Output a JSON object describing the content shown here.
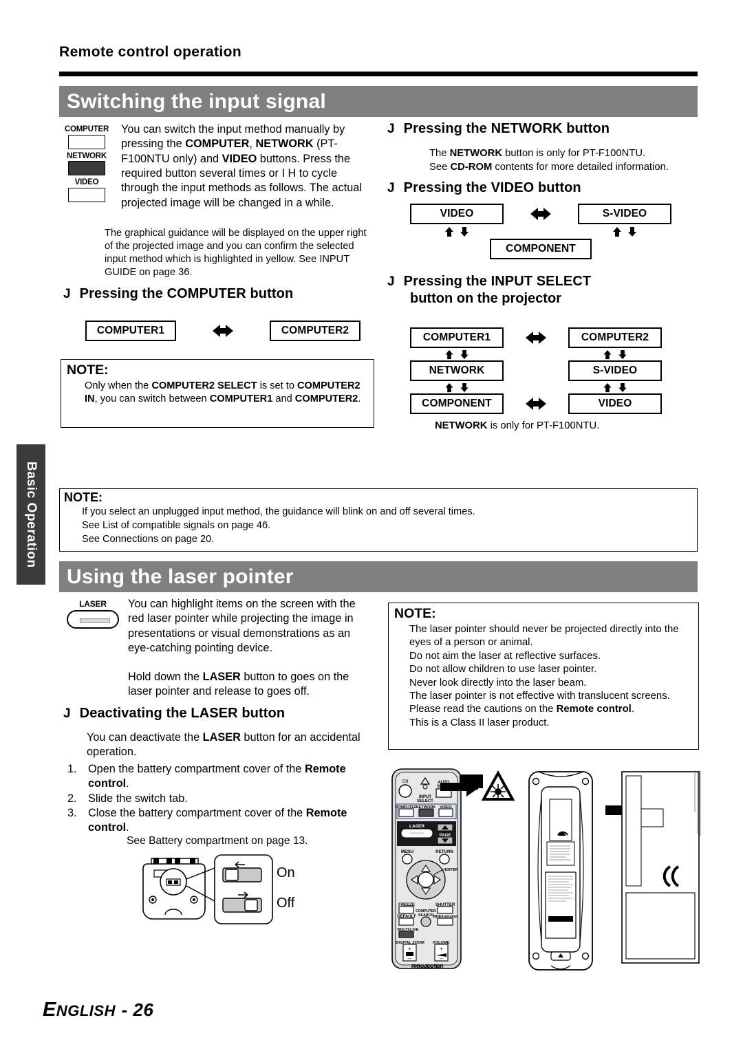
{
  "page": {
    "running_head": "Remote control operation",
    "footer_lead": "E",
    "footer_rest": "NGLISH",
    "footer_page": "- 26",
    "side_tab": "Basic Operation",
    "accent_gray": "#808080",
    "tab_gray": "#3b3b3b"
  },
  "section_switching": {
    "title": "Switching the input signal",
    "remote_keys": [
      {
        "label": "COMPUTER",
        "state": "light"
      },
      {
        "label": "NETWORK",
        "state": "dark"
      },
      {
        "label": "VIDEO",
        "state": "light"
      }
    ],
    "intro": {
      "l1a": "You can switch the input method manually by pressing the ",
      "l1b": "COMPUTER",
      "l1c": ", ",
      "l1d": "NETWORK",
      "l2a": " (PT-F100NTU only) and ",
      "l2b": "VIDEO",
      "l2c": " buttons. Press the required button several times or I H  to cycle through the input methods as follows. The actual projected image will be changed in a while."
    },
    "intro_note": "The graphical guidance will be displayed on the upper right of the projected image and you can confirm the selected input method which is highlighted in yellow. See  INPUT GUIDE  on page 36.",
    "computer_heading": {
      "bullet": "J",
      "text": "Pressing the COMPUTER button"
    },
    "computer_flow": {
      "left": "COMPUTER1",
      "arrow": "bidirectional-arrow",
      "right": "COMPUTER2"
    },
    "computer_note": {
      "head": "NOTE:",
      "a": "Only when the ",
      "b": "COMPUTER2 SELECT",
      "c": " is set to ",
      "d": "COMPUTER2 IN",
      "e": ", you can switch between ",
      "f": "COMPUTER1",
      "g": " and ",
      "h": "COMPUTER2",
      "i": "."
    },
    "network_heading": {
      "bullet": "J",
      "text": "Pressing the NETWORK button"
    },
    "network_body": {
      "l1a": "The ",
      "l1b": "NETWORK",
      "l1c": " button is only for PT-F100NTU.",
      "l2a": "See ",
      "l2b": "CD-ROM",
      "l2c": " contents for more detailed information."
    },
    "video_heading": {
      "bullet": "J",
      "text": "Pressing the VIDEO button"
    },
    "video_flow": {
      "video": "VIDEO",
      "svideo": "S-VIDEO",
      "component": "COMPONENT"
    },
    "inputselect_heading": {
      "bullet": "J",
      "line1": "Pressing the INPUT SELECT",
      "line2": "button on the projector"
    },
    "inputselect_flow": {
      "computer1": "COMPUTER1",
      "computer2": "COMPUTER2",
      "network": "NETWORK",
      "svideo": "S-VIDEO",
      "component": "COMPONENT",
      "video": "VIDEO"
    },
    "inputselect_footnote": {
      "a": "NETWORK",
      "b": " is only for PT-F100NTU."
    },
    "big_note": {
      "head": "NOTE:",
      "lines": [
        "If you select an unplugged input method, the guidance will blink on and off several times.",
        "See  List of compatible signals  on page 46.",
        "See  Connections  on page 20."
      ]
    }
  },
  "section_laser": {
    "title": "Using the laser pointer",
    "key_label": "LASER",
    "intro_p1": "You can highlight items on the screen with the red laser pointer while projecting the image in presentations or visual demonstrations as an eye-catching pointing device.",
    "intro_p2a": "Hold down the ",
    "intro_p2b": "LASER",
    "intro_p2c": " button to goes on the laser pointer and release to goes off.",
    "deactivate_heading": {
      "bullet": "J",
      "text": "Deactivating the LASER button"
    },
    "deactivate_lead_a": "You can deactivate the ",
    "deactivate_lead_b": "LASER",
    "deactivate_lead_c": " button for an accidental operation.",
    "steps": [
      {
        "num": "1.",
        "a": "Open the battery compartment cover of the ",
        "b": "Remote control",
        "c": "."
      },
      {
        "num": "2.",
        "a": "Slide the switch tab.",
        "b": "",
        "c": ""
      },
      {
        "num": "3.",
        "a": "Close the battery compartment cover of the ",
        "b": "Remote control",
        "c": "."
      }
    ],
    "see_ref": "See  Battery compartment  on page 13.",
    "switch_on": "On",
    "switch_off": "Off",
    "note": {
      "head": "NOTE:",
      "lines": [
        "The laser pointer should never be projected directly into the eyes of a person or animal.",
        "Do not aim the laser at reflective surfaces.",
        "Do not allow children to use laser pointer.",
        "Never look directly into the laser beam.",
        "The laser pointer is not effective with translucent screens."
      ],
      "line_read_a": "Please read the cautions on the ",
      "line_read_b": "Remote control",
      "line_read_c": ".",
      "line_class": "This is a Class II laser product."
    },
    "remote_illustration": {
      "power": "⏻/I",
      "auto_setup_l1": "AUTO",
      "auto_setup_l2": "SETUP",
      "input_select_l1": "INPUT",
      "input_select_l2": "SELECT",
      "computer": "COMPUTER",
      "network": "NETWORK",
      "video": "VIDEO",
      "laser": "LASER",
      "page": "PAGE",
      "menu": "MENU",
      "return": "RETURN",
      "enter": "ENTER",
      "freeze": "FREEZE",
      "shutter": "SHUTTER",
      "default": "DEFAULT",
      "computer_search_l1": "COMPUTER",
      "computer_search_l2": "SEARCH",
      "index_window": "INDEX-window",
      "multi_live": "MULTI-LIVE",
      "digital_zoom": "DIGITAL ZOOM",
      "volume": "VOLUME",
      "brand": "Panasonic",
      "brand_sub": "PROJECTOR",
      "caution_label": "CAUTION"
    }
  }
}
